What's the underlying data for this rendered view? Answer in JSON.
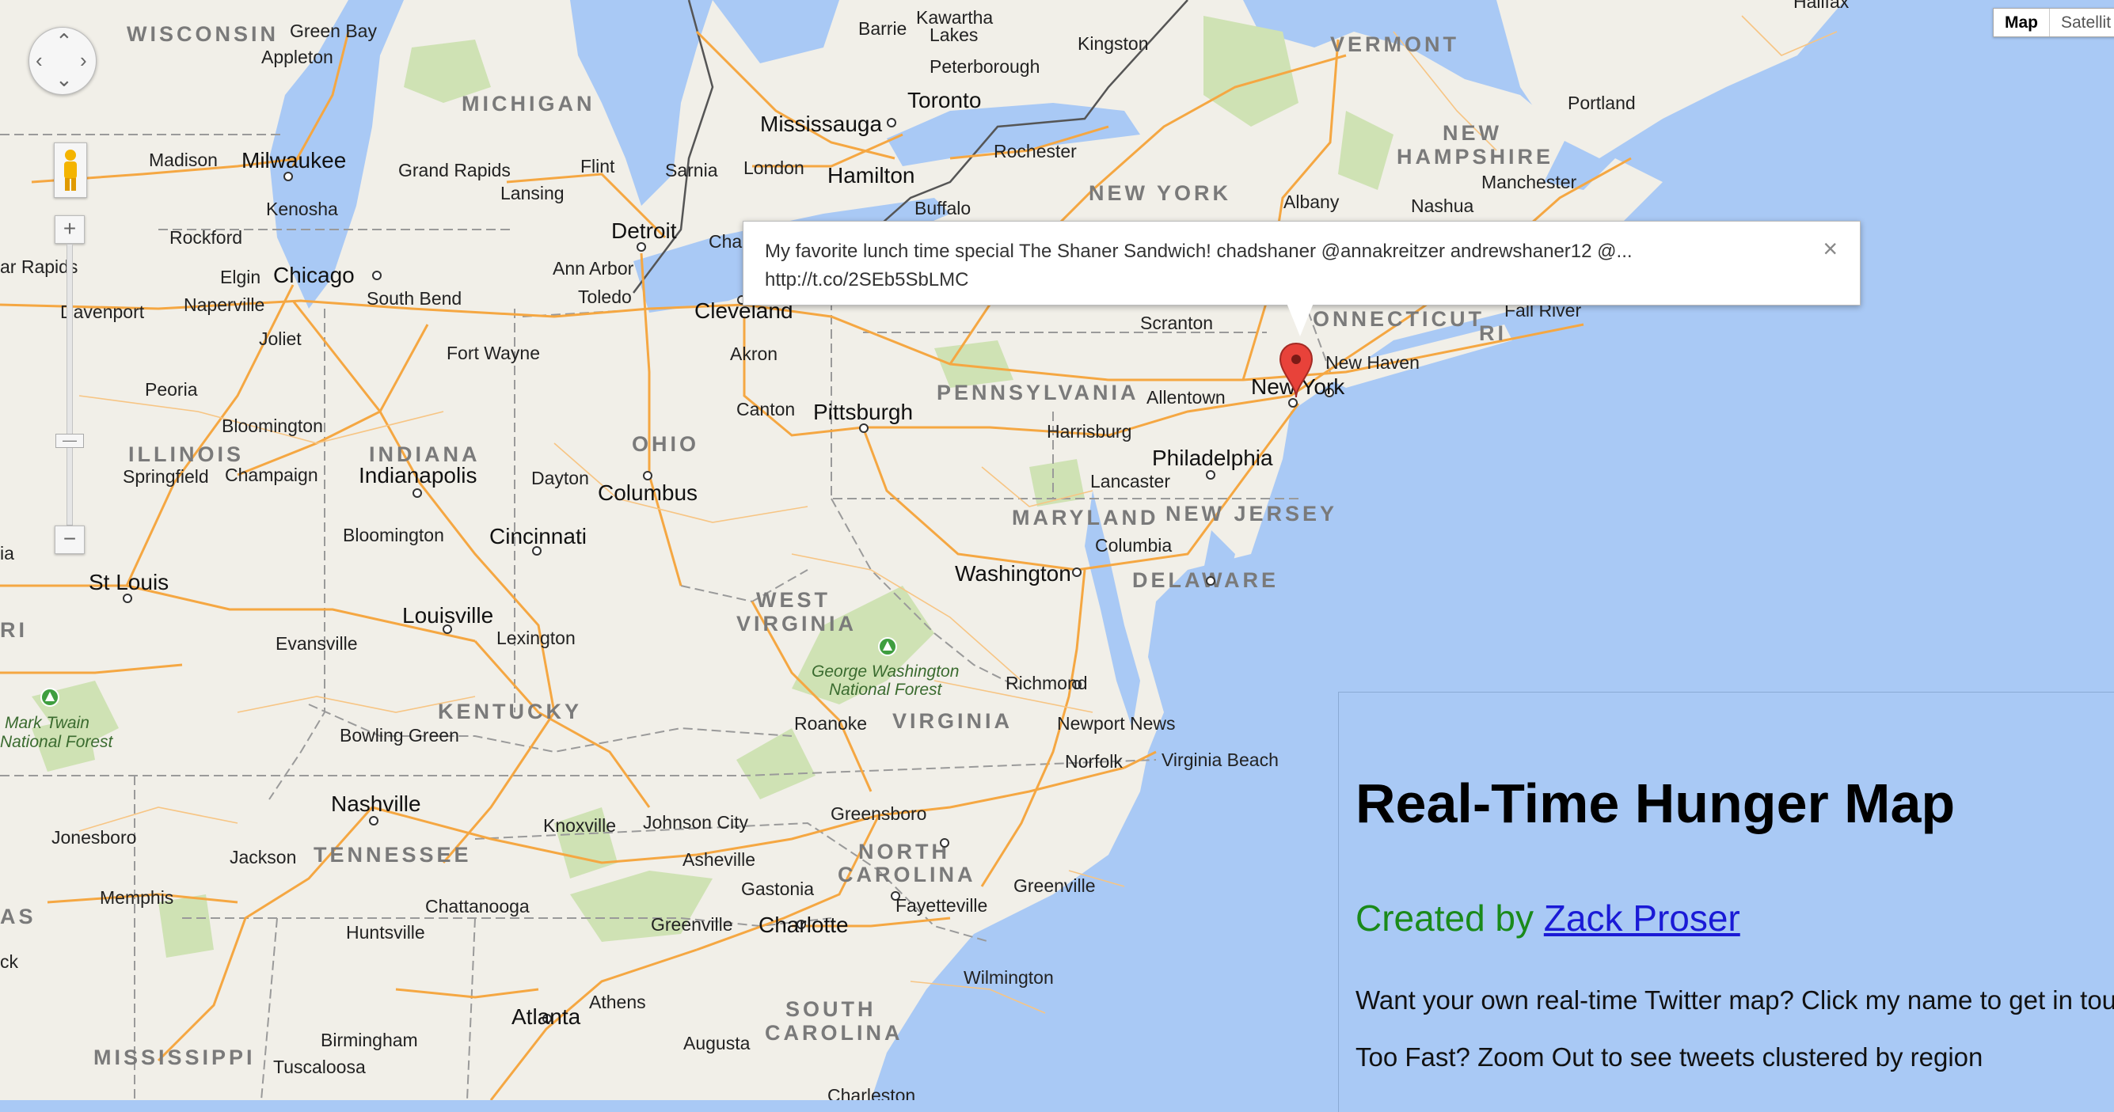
{
  "map": {
    "type_control": {
      "map_label": "Map",
      "satellite_label": "Satellit"
    },
    "labels": {
      "states": {
        "wisconsin": "WISCONSIN",
        "michigan": "MICHIGAN",
        "vermont": "VERMONT",
        "new_hampshire_1": "NEW",
        "new_hampshire_2": "HAMPSHIRE",
        "new_york": "NEW YORK",
        "connecticut": "ONNECTICUT",
        "ri": "RI",
        "pennsylvania": "PENNSYLVANIA",
        "ohio": "OHIO",
        "indiana": "INDIANA",
        "illinois": "ILLINOIS",
        "maryland": "MARYLAND",
        "new_jersey": "NEW JERSEY",
        "delaware": "DELAWARE",
        "west_virginia_1": "WEST",
        "west_virginia_2": "VIRGINIA",
        "virginia": "VIRGINIA",
        "kentucky": "KENTUCKY",
        "tennessee": "TENNESSEE",
        "north_carolina_1": "NORTH",
        "north_carolina_2": "CAROLINA",
        "south_carolina_1": "SOUTH",
        "south_carolina_2": "CAROLINA",
        "mississippi": "MISSISSIPPI",
        "ri_west": "RI",
        "as_west": "AS"
      },
      "cities": {
        "green_bay": "Green Bay",
        "appleton": "Appleton",
        "barrie": "Barrie",
        "kawartha_1": "Kawartha",
        "kawartha_2": "Lakes",
        "peterborough": "Peterborough",
        "kingston": "Kingston",
        "halifax": "Halifax",
        "portland": "Portland",
        "manchester": "Manchester",
        "nashua": "Nashua",
        "albany": "Albany",
        "toronto": "Toronto",
        "mississauga": "Mississauga",
        "hamilton": "Hamilton",
        "rochester": "Rochester",
        "buffalo": "Buffalo",
        "madison": "Madison",
        "milwaukee": "Milwaukee",
        "kenosha": "Kenosha",
        "grand_rapids": "Grand Rapids",
        "flint": "Flint",
        "sarnia": "Sarnia",
        "london": "London",
        "lansing": "Lansing",
        "detroit": "Detroit",
        "ann_arbor": "Ann Arbor",
        "toledo": "Toledo",
        "cha": "Cha",
        "rockford": "Rockford",
        "elgin": "Elgin",
        "chicago": "Chicago",
        "naperville": "Naperville",
        "joliet": "Joliet",
        "south_bend": "South Bend",
        "davenport": "Davenport",
        "ar_rapids": "ar Rapids",
        "cleveland": "Cleveland",
        "akron": "Akron",
        "canton": "Canton",
        "pittsburgh": "Pittsburgh",
        "scranton": "Scranton",
        "fall_river": "Fall River",
        "new_haven": "New Haven",
        "new_york": "New York",
        "allentown": "Allentown",
        "harrisburg": "Harrisburg",
        "philadelphia": "Philadelphia",
        "lancaster": "Lancaster",
        "fort_wayne": "Fort Wayne",
        "peoria": "Peoria",
        "bloomington_il": "Bloomington",
        "springfield": "Springfield",
        "champaign": "Champaign",
        "indianapolis": "Indianapolis",
        "dayton": "Dayton",
        "columbus": "Columbus",
        "columbia": "Columbia",
        "washington": "Washington",
        "bloomington_in": "Bloomington",
        "cincinnati": "Cincinnati",
        "st_louis": "St Louis",
        "louisville": "Louisville",
        "lexington": "Lexington",
        "evansville": "Evansville",
        "richmond": "Richmond",
        "mark_twain_1": "Mark Twain",
        "mark_twain_2": "National Forest",
        "bowling_green": "Bowling Green",
        "roanoke": "Roanoke",
        "newport_news": "Newport News",
        "norfolk": "Norfolk",
        "virginia_beach": "Virginia Beach",
        "nashville": "Nashville",
        "knoxville": "Knoxville",
        "johnson_city": "Johnson City",
        "greensboro": "Greensboro",
        "jonesboro": "Jonesboro",
        "jackson": "Jackson",
        "asheville": "Asheville",
        "memphis": "Memphis",
        "gastonia": "Gastonia",
        "fayetteville": "Fayetteville",
        "greenville_nc": "Greenville",
        "chattanooga": "Chattanooga",
        "greenville_sc": "Greenville",
        "charlotte": "Charlotte",
        "huntsville": "Huntsville",
        "wilmington": "Wilmington",
        "athens": "Athens",
        "atlanta": "Atlanta",
        "birmingham": "Birmingham",
        "augusta": "Augusta",
        "tuscaloosa": "Tuscaloosa",
        "ia_west": "ia",
        "ck_west": "ck",
        "charleston": "Charleston"
      },
      "parks": {
        "george_washington_1": "George Washington",
        "george_washington_2": "National Forest"
      }
    }
  },
  "infowindow": {
    "line1": "My favorite lunch time special The Shaner Sandwich!      chadshaner @annakreitzer andrewshaner12 @...",
    "line2": "http://t.co/2SEb5SbLMC",
    "close": "×"
  },
  "panel": {
    "title": "Real-Time Hunger Map",
    "credit_prefix": "Created by ",
    "author": "Zack Proser",
    "cta": "Want your own real-time Twitter map? Click my name to get in touch",
    "hint": "Too Fast? Zoom Out to see tweets clustered by region"
  },
  "colors": {
    "water": "#a9c9f5",
    "land": "#f1efe8",
    "highway": "#f5a742",
    "border": "#9a9a9a",
    "marker": "#e8423a",
    "credit": "#1a8a1a",
    "link": "#1a1ad6"
  }
}
